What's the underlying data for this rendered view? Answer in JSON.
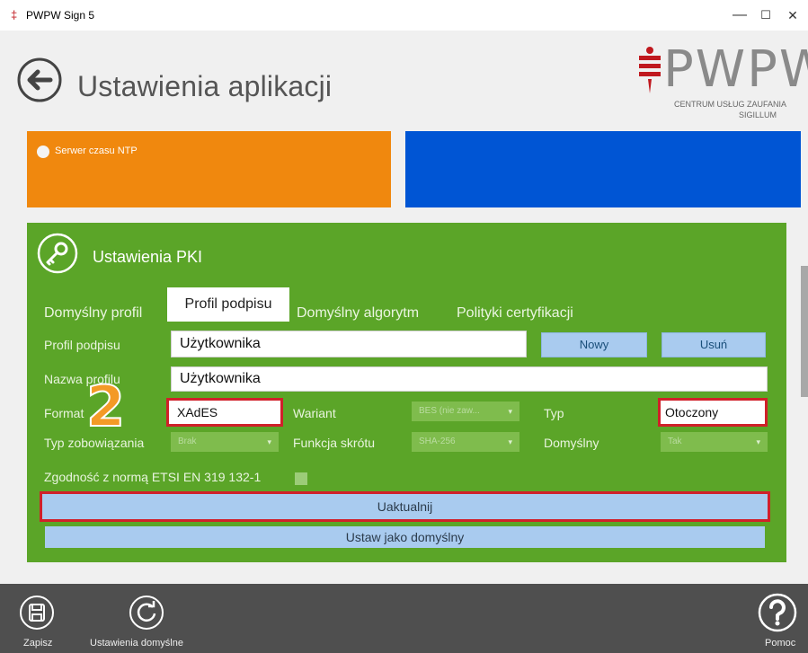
{
  "window": {
    "title": "PWPW Sign 5",
    "controls": {
      "minimize": "—",
      "maximize": "☐",
      "close": "✕"
    }
  },
  "header": {
    "title": "Ustawienia aplikacji",
    "logo": {
      "text": "PWPW",
      "subtitle_line1": "CENTRUM USŁUG ZAUFANIA",
      "subtitle_line2": "SIGILLUM"
    }
  },
  "time_section": {
    "radio_label": "Serwer czasu NTP"
  },
  "pki": {
    "title": "Ustawienia PKI",
    "tabs": [
      {
        "label": "Domyślny profil",
        "active": false
      },
      {
        "label": "Profil podpisu",
        "active": true
      },
      {
        "label": "Domyślny algorytm",
        "active": false
      },
      {
        "label": "Polityki certyfikacji",
        "active": false
      }
    ],
    "fields": {
      "profile_label": "Profil podpisu",
      "profile_value": "Użytkownika",
      "new_button": "Nowy",
      "delete_button": "Usuń",
      "name_label": "Nazwa profilu",
      "name_value": "Użytkownika",
      "format_label": "Format",
      "format_value": "XAdES",
      "variant_label": "Wariant",
      "variant_value": "BES (nie zaw...",
      "type_label": "Typ",
      "type_value": "Otoczony",
      "commitment_label": "Typ zobowiązania",
      "commitment_value": "Brak",
      "hash_label": "Funkcja skrótu",
      "hash_value": "SHA-256",
      "default_label": "Domyślny",
      "default_value": "Tak",
      "etsi_label": "Zgodność z normą ETSI EN 319 132-1"
    },
    "update_button": "Uaktualnij",
    "set_default_button": "Ustaw jako domyślny"
  },
  "annotation": {
    "step": "2"
  },
  "footer": {
    "save": "Zapisz",
    "defaults": "Ustawienia domyślne",
    "help": "Pomoc"
  },
  "colors": {
    "orange": "#f0880e",
    "blue": "#0055d4",
    "green": "#5ba528",
    "highlight_red": "#d0202a",
    "button_blue": "#a9cbef"
  }
}
